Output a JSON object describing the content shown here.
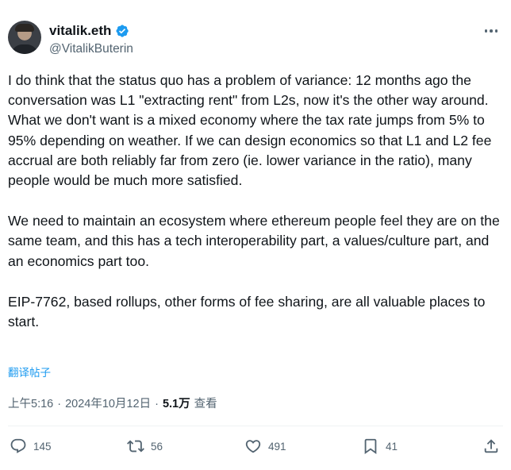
{
  "author": {
    "display_name": "vitalik.eth",
    "handle": "@VitalikButerin",
    "verified": true,
    "verified_color": "#1d9bf0"
  },
  "tweet": {
    "paragraphs": [
      "I do think that the status quo has a problem of variance: 12 months ago the conversation was L1 \"extracting rent\" from L2s, now it's the other way around. What we don't want is a mixed economy where the tax rate jumps from 5% to 95% depending on weather. If we can design economics so that L1 and L2 fee accrual are both reliably far from zero (ie. lower variance in the ratio), many people would be much more satisfied.",
      "We need to maintain an ecosystem where ethereum people feel they are on the same team, and this has a tech interoperability part, a values/culture part, and an economics part too.",
      "EIP-7762, based rollups, other forms of fee sharing, are all valuable places to start."
    ],
    "translate_label": "翻译帖子"
  },
  "meta": {
    "time": "上午5:16",
    "separator": "·",
    "date": "2024年10月12日",
    "views_count": "5.1万",
    "views_label": "查看"
  },
  "actions": {
    "replies": "145",
    "retweets": "56",
    "likes": "491",
    "bookmarks": "41"
  },
  "icons": {
    "more": "more-horizontal-icon",
    "verified": "verified-badge-icon",
    "reply": "reply-icon",
    "retweet": "retweet-icon",
    "like": "heart-icon",
    "bookmark": "bookmark-icon",
    "share": "share-icon"
  },
  "colors": {
    "text": "#0f1419",
    "secondary": "#536471",
    "link": "#1d9bf0",
    "divider": "#eff3f4"
  }
}
